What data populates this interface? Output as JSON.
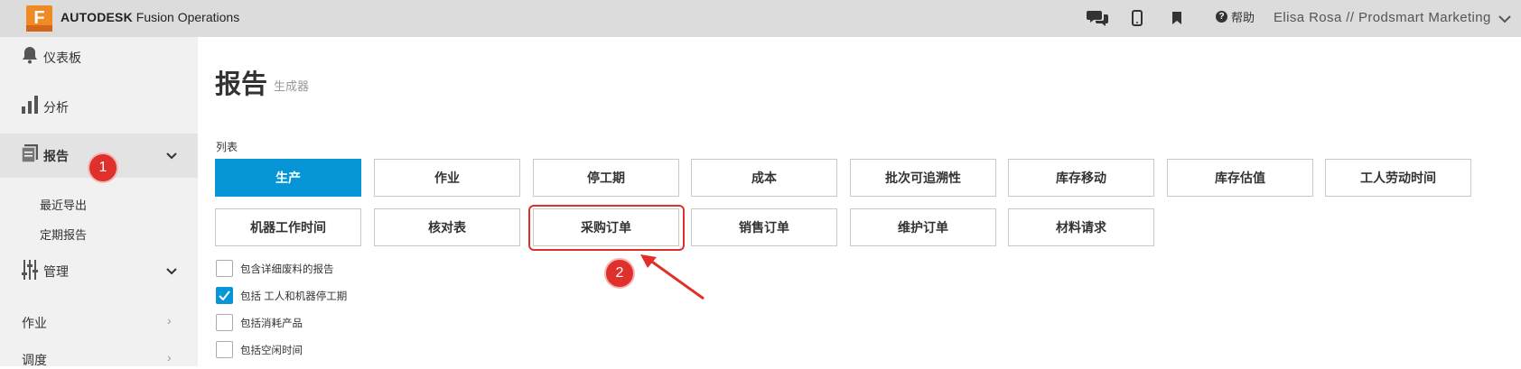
{
  "header": {
    "logo_letter": "F",
    "brand_bold": "AUTODESK",
    "brand_rest": "Fusion Operations",
    "help_label": "帮助",
    "user": "Elisa Rosa // Prodsmart Marketing",
    "icons": [
      "chat-icon",
      "mobile-icon",
      "bookmark-icon",
      "help-icon",
      "chevron-down-icon"
    ]
  },
  "sidebar": {
    "dashboard": "仪表板",
    "analysis": "分析",
    "reports": "报告",
    "reports_sub": [
      "最近导出",
      "定期报告"
    ],
    "manage": "管理",
    "jobs": "作业",
    "scheduling": "调度"
  },
  "annotations": {
    "step1": "1",
    "step2": "2",
    "highlight_color": "#e0302b"
  },
  "main": {
    "title": "报告",
    "subtitle": "生成器",
    "list_label": "列表",
    "buttons_row1": [
      "生产",
      "作业",
      "停工期",
      "成本",
      "批次可追溯性",
      "库存移动",
      "库存估值",
      "工人劳动时间"
    ],
    "buttons_row2": [
      "机器工作时间",
      "核对表",
      "采购订单",
      "销售订单",
      "维护订单",
      "材料请求"
    ],
    "active_button": "生产",
    "checkboxes": [
      {
        "label": "包含详细废料的报告",
        "checked": false
      },
      {
        "label": "包括 工人和机器停工期",
        "checked": true
      },
      {
        "label": "包括消耗产品",
        "checked": false
      },
      {
        "label": "包括空闲时间",
        "checked": false
      }
    ]
  },
  "colors": {
    "accent": "#0696d7",
    "brand_orange": "#f08a24",
    "topbar": "#dcdcdc",
    "sidebar": "#f1f1f1"
  }
}
